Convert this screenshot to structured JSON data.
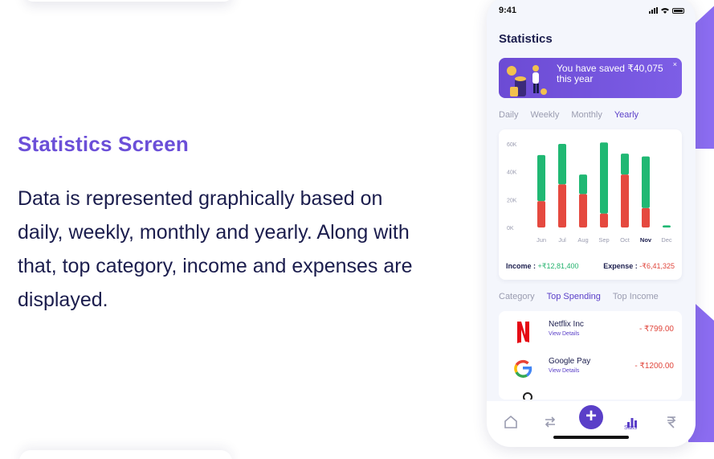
{
  "intro": {
    "heading": "Statistics Screen",
    "description": "Data is represented graphically based on daily, weekly, monthly and yearly. Along with that, top category, income and expenses are displayed."
  },
  "status_bar": {
    "time": "9:41"
  },
  "screen": {
    "title": "Statistics"
  },
  "banner": {
    "text": "You have saved ₹40,075 this year",
    "close_icon": "×"
  },
  "period_tabs": [
    {
      "label": "Daily",
      "active": false
    },
    {
      "label": "Weekly",
      "active": false
    },
    {
      "label": "Monthly",
      "active": false
    },
    {
      "label": "Yearly",
      "active": true
    }
  ],
  "chart_data": {
    "type": "bar",
    "stacked": true,
    "categories": [
      "Jun",
      "Jul",
      "Aug",
      "Sep",
      "Oct",
      "Nov",
      "Dec"
    ],
    "selected_category": "Nov",
    "series": [
      {
        "name": "Expense",
        "color": "#e5493f",
        "values": [
          19000,
          31000,
          24000,
          10000,
          38000,
          14000,
          0
        ]
      },
      {
        "name": "Income",
        "color": "#20b873",
        "values": [
          33000,
          29000,
          14000,
          51000,
          15000,
          37000,
          1500
        ]
      }
    ],
    "y_ticks": [
      "60K",
      "40K",
      "20K",
      "0K"
    ],
    "ylim": [
      0,
      60000
    ],
    "grid": false
  },
  "summary": {
    "income_label": "Income :",
    "income_value": "+₹12,81,400",
    "expense_label": "Expense :",
    "expense_value": "-₹6,41,325"
  },
  "category_tabs": [
    {
      "label": "Category",
      "active": false
    },
    {
      "label": "Top Spending",
      "active": true
    },
    {
      "label": "Top Income",
      "active": false
    }
  ],
  "spending_list": [
    {
      "name": "Netflix Inc",
      "link": "View Details",
      "amount": "- ₹799.00",
      "icon": "netflix-logo"
    },
    {
      "name": "Google Pay",
      "link": "View Details",
      "amount": "- ₹1200.00",
      "icon": "google-logo"
    }
  ],
  "nav": {
    "items": [
      "home-icon",
      "transfer-icon",
      "add-icon",
      "stats-icon",
      "rupee-icon"
    ],
    "add_label": "+",
    "stats_label": "Stats",
    "active": "stats-icon",
    "accent": "#5a3fc8"
  }
}
